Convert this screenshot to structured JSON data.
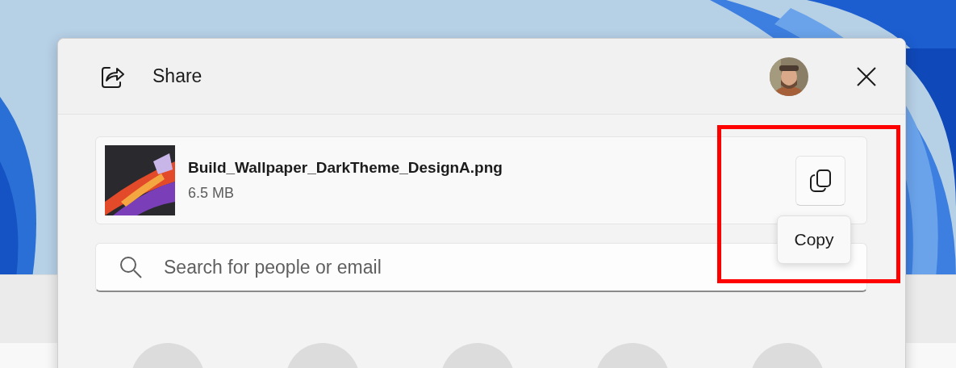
{
  "dialog": {
    "title": "Share",
    "file": {
      "name": "Build_Wallpaper_DarkTheme_DesignA.png",
      "size": "6.5 MB"
    },
    "copy_tooltip": "Copy",
    "search": {
      "placeholder": "Search for people or email"
    },
    "contacts": [
      {
        "kind": "placeholder"
      },
      {
        "kind": "placeholder"
      },
      {
        "kind": "placeholder"
      },
      {
        "kind": "placeholder"
      },
      {
        "kind": "placeholder"
      }
    ]
  },
  "annotations": [
    {
      "kind": "rectangle",
      "color": "#ff0000"
    }
  ]
}
